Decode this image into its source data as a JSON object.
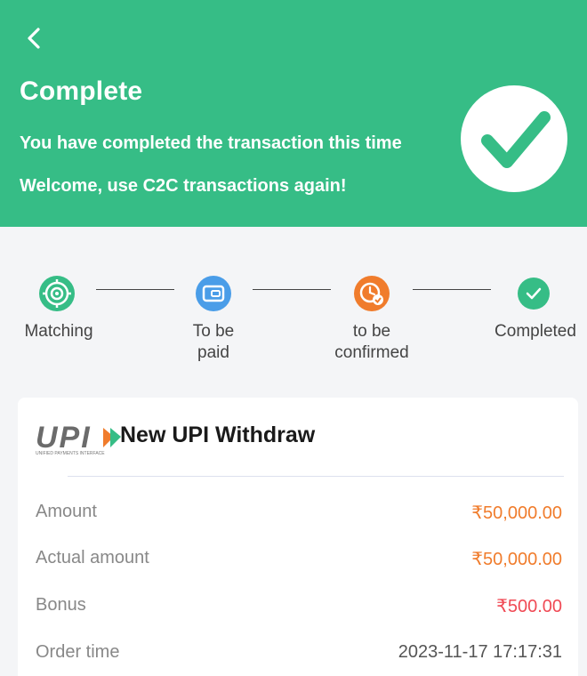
{
  "header": {
    "title": "Complete",
    "line1": "You have completed the transaction this time",
    "line2": "Welcome, use C2C transactions again!",
    "bg_color": "#36bd86",
    "check_color": "#36bd86"
  },
  "steps": [
    {
      "label": "Matching",
      "icon": "target-icon",
      "color": "#36bd86"
    },
    {
      "label": "To be\npaid",
      "icon": "wallet-icon",
      "color": "#4a9de8"
    },
    {
      "label": "to be\nconfirmed",
      "icon": "clock-check-icon",
      "color": "#f07c2c"
    },
    {
      "label": "Completed",
      "icon": "check-icon",
      "color": "#36bd86"
    }
  ],
  "card": {
    "logo_text": "UPI",
    "logo_tagline": "UNIFIED PAYMENTS INTERFACE",
    "title": "New UPI Withdraw",
    "rows": [
      {
        "label": "Amount",
        "value": "₹50,000.00",
        "tone": "orange"
      },
      {
        "label": "Actual amount",
        "value": "₹50,000.00",
        "tone": "orange"
      },
      {
        "label": "Bonus",
        "value": "₹500.00",
        "tone": "red"
      },
      {
        "label": "Order time",
        "value": "2023-11-17 17:17:31",
        "tone": "dark"
      }
    ]
  }
}
